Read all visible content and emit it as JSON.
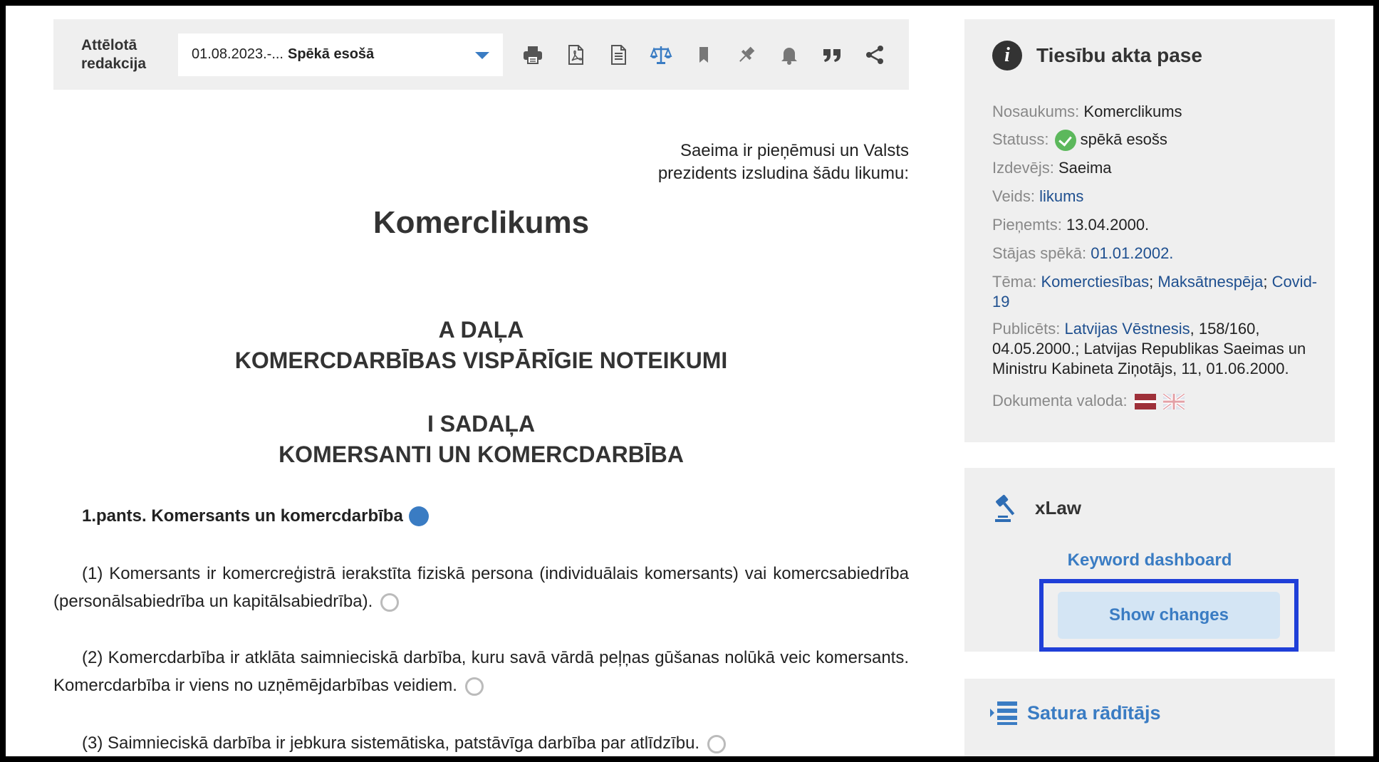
{
  "toolbar": {
    "label": "Attēlotā redakcija",
    "select_value_prefix": "01.08.2023.-...",
    "select_value_bold": "Spēkā esošā",
    "icons": [
      "print-icon",
      "pdf-icon",
      "document-icon",
      "scales-icon",
      "bookmark-icon",
      "pin-icon",
      "bell-icon",
      "quote-icon",
      "share-icon"
    ],
    "accent_color": "#3a7cc3"
  },
  "document": {
    "preamble_line1": "Saeima ir pieņēmusi un Valsts",
    "preamble_line2": "prezidents izsludina šādu likumu:",
    "title": "Komerclikums",
    "part_a_line1": "A DAĻA",
    "part_a_line2": "KOMERCDARBĪBAS VISPĀRĪGIE NOTEIKUMI",
    "section_i_line1": "I SADAĻA",
    "section_i_line2": "KOMERSANTI UN KOMERCDARBĪBA",
    "article_1_heading": "1.pants. Komersants un komercdarbība",
    "paragraphs": [
      "(1) Komersants ir komercreģistrā ierakstīta fiziskā persona (individuālais komersants) vai komercsabiedrība (personālsabiedrība un kapitālsabiedrība).",
      "(2) Komercdarbība ir atklāta saimnieciskā darbība, kuru savā vārdā peļņas gūšanas nolūkā veic komersants. Komercdarbība ir viens no uzņēmējdarbības veidiem.",
      "(3) Saimnieciskā darbība ir jebkura sistemātiska, patstāvīga darbība par atlīdzību."
    ]
  },
  "pase": {
    "title": "Tiesību akta pase",
    "nosaukums_label": "Nosaukums:",
    "nosaukums_value": "Komerclikums",
    "statuss_label": "Statuss:",
    "statuss_value": "spēkā esošs",
    "izdevejs_label": "Izdevējs:",
    "izdevejs_value": "Saeima",
    "veids_label": "Veids:",
    "veids_value": "likums",
    "pienemts_label": "Pieņemts:",
    "pienemts_value": "13.04.2000.",
    "stajas_label": "Stājas spēkā:",
    "stajas_value": "01.01.2002.",
    "tema_label": "Tēma:",
    "tema_1": "Komerctiesības",
    "tema_2": "Maksātnespēja",
    "tema_3": "Covid-19",
    "publicets_label": "Publicēts:",
    "publicets_link": "Latvijas Vēstnesis",
    "publicets_rest": ", 158/160, 04.05.2000.; Latvijas Republikas Saeimas un Ministru Kabineta Ziņotājs, 11, 01.06.2000.",
    "valoda_label": "Dokumenta valoda:",
    "status_color": "#5cb85c"
  },
  "xlaw": {
    "title": "xLaw",
    "keyword_dashboard": "Keyword dashboard",
    "show_changes": "Show changes",
    "highlight_color": "#1f3fd8"
  },
  "toc": {
    "title": "Satura rādītājs"
  }
}
